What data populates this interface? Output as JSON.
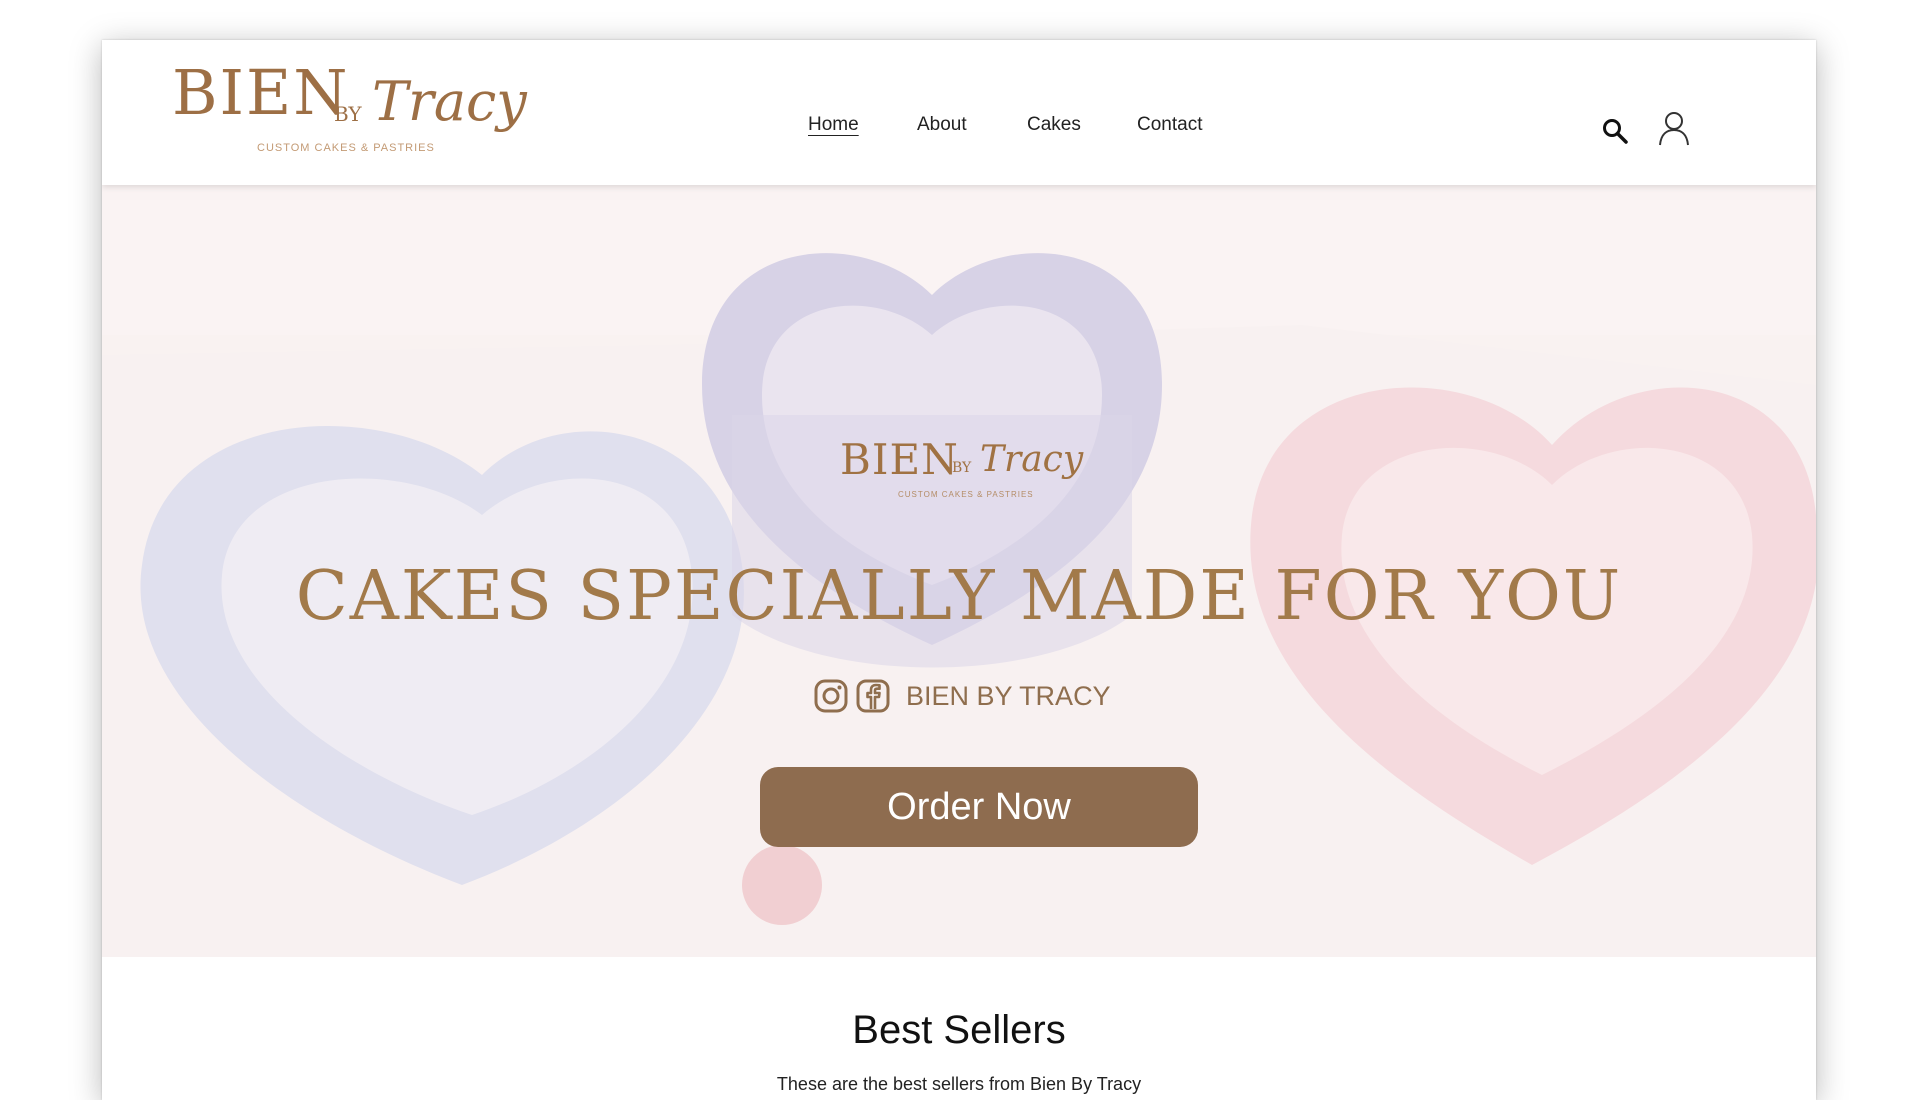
{
  "brand": {
    "logo_main": "BIEN",
    "logo_by": "BY",
    "logo_script": "Tracy",
    "logo_tagline": "CUSTOM CAKES & PASTRIES",
    "color": "#9d6f45"
  },
  "nav": {
    "items": [
      {
        "label": "Home",
        "active": true
      },
      {
        "label": "About",
        "active": false
      },
      {
        "label": "Cakes",
        "active": false
      },
      {
        "label": "Contact",
        "active": false
      }
    ]
  },
  "header_icons": [
    "search-icon",
    "user-icon"
  ],
  "hero": {
    "logo_main": "BIEN",
    "logo_by": "BY",
    "logo_script": "Tracy",
    "logo_tagline": "CUSTOM CAKES & PASTRIES",
    "title": "CAKES SPECIALLY MADE FOR YOU",
    "social_icons": [
      "instagram-icon",
      "facebook-icon"
    ],
    "social_handle": "BIEN BY TRACY",
    "cta_label": "Order Now",
    "cta_color": "#8e6c4f"
  },
  "best_sellers": {
    "title": "Best Sellers",
    "subtitle": "These are the best sellers from Bien By Tracy"
  }
}
